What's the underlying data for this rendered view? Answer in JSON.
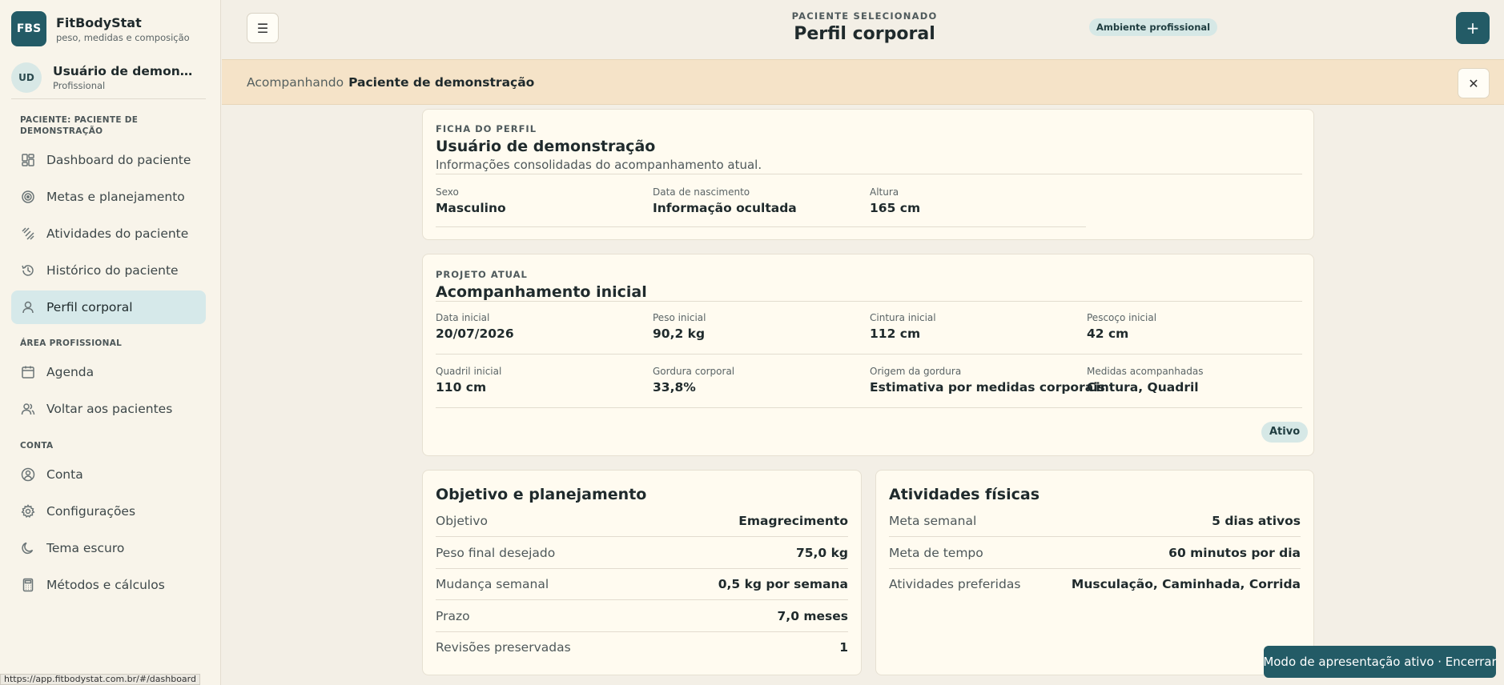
{
  "brand": {
    "logo": "FBS",
    "name": "FitBodyStat",
    "subtitle": "peso, medidas e composição"
  },
  "user": {
    "initials": "UD",
    "name": "Usuário de demonstração",
    "role": "Profissional"
  },
  "sidebar": {
    "patient_section": "PACIENTE: PACIENTE DE DEMONSTRAÇÃO",
    "patient_items": [
      {
        "label": "Dashboard do paciente",
        "icon": "dashboard-icon"
      },
      {
        "label": "Metas e planejamento",
        "icon": "target-icon"
      },
      {
        "label": "Atividades do paciente",
        "icon": "activity-icon"
      },
      {
        "label": "Histórico do paciente",
        "icon": "history-icon"
      },
      {
        "label": "Perfil corporal",
        "icon": "person-icon",
        "active": true
      }
    ],
    "pro_section": "ÁREA PROFISSIONAL",
    "pro_items": [
      {
        "label": "Agenda",
        "icon": "calendar-icon"
      },
      {
        "label": "Voltar aos pacientes",
        "icon": "users-icon"
      }
    ],
    "account_section": "CONTA",
    "account_items": [
      {
        "label": "Conta",
        "icon": "account-icon"
      },
      {
        "label": "Configurações",
        "icon": "gear-icon"
      },
      {
        "label": "Tema escuro",
        "icon": "moon-icon"
      },
      {
        "label": "Métodos e cálculos",
        "icon": "calculator-icon"
      }
    ]
  },
  "status_url": "https://app.fitbodystat.com.br/#/dashboard",
  "header": {
    "menu_icon": "☰",
    "kicker": "PACIENTE SELECIONADO",
    "title": "Perfil corporal",
    "env_badge": "Ambiente profissional",
    "plus_label": "+"
  },
  "banner": {
    "prefix": "Acompanhando",
    "patient": "Paciente de demonstração",
    "close_label": "✕"
  },
  "profile_card": {
    "kicker": "FICHA DO PERFIL",
    "title": "Usuário de demonstração",
    "description": "Informações consolidadas do acompanhamento atual.",
    "fields": [
      {
        "label": "Sexo",
        "value": "Masculino"
      },
      {
        "label": "Data de nascimento",
        "value": "Informação ocultada"
      },
      {
        "label": "Altura",
        "value": "165 cm"
      }
    ]
  },
  "project_card": {
    "kicker": "PROJETO ATUAL",
    "title": "Acompanhamento inicial",
    "fields": [
      {
        "label": "Data inicial",
        "value": "20/07/2026"
      },
      {
        "label": "Peso inicial",
        "value": "90,2 kg"
      },
      {
        "label": "Cintura inicial",
        "value": "112 cm"
      },
      {
        "label": "Pescoço inicial",
        "value": "42 cm"
      },
      {
        "label": "Quadril inicial",
        "value": "110 cm"
      },
      {
        "label": "Gordura corporal",
        "value": "33,8%"
      },
      {
        "label": "Origem da gordura",
        "value": "Estimativa por medidas corporais"
      },
      {
        "label": "Medidas acompanhadas",
        "value": "Cintura, Quadril"
      }
    ],
    "status_badge": "Ativo"
  },
  "goal_card": {
    "title": "Objetivo e planejamento",
    "rows": [
      {
        "label": "Objetivo",
        "value": "Emagrecimento"
      },
      {
        "label": "Peso final desejado",
        "value": "75,0 kg"
      },
      {
        "label": "Mudança semanal",
        "value": "0,5 kg por semana"
      },
      {
        "label": "Prazo",
        "value": "7,0 meses"
      },
      {
        "label": "Revisões preservadas",
        "value": "1"
      }
    ]
  },
  "activity_card": {
    "title": "Atividades físicas",
    "rows": [
      {
        "label": "Meta semanal",
        "value": "5 dias ativos"
      },
      {
        "label": "Meta de tempo",
        "value": "60 minutos por dia"
      },
      {
        "label": "Atividades preferidas",
        "value": "Musculação, Caminhada, Corrida"
      }
    ]
  },
  "presentation_button": "Modo de apresentação ativo · Encerrar",
  "colors": {
    "accent": "#235b66",
    "active_nav": "#d6e9ea",
    "banner": "#f5e3c8"
  }
}
